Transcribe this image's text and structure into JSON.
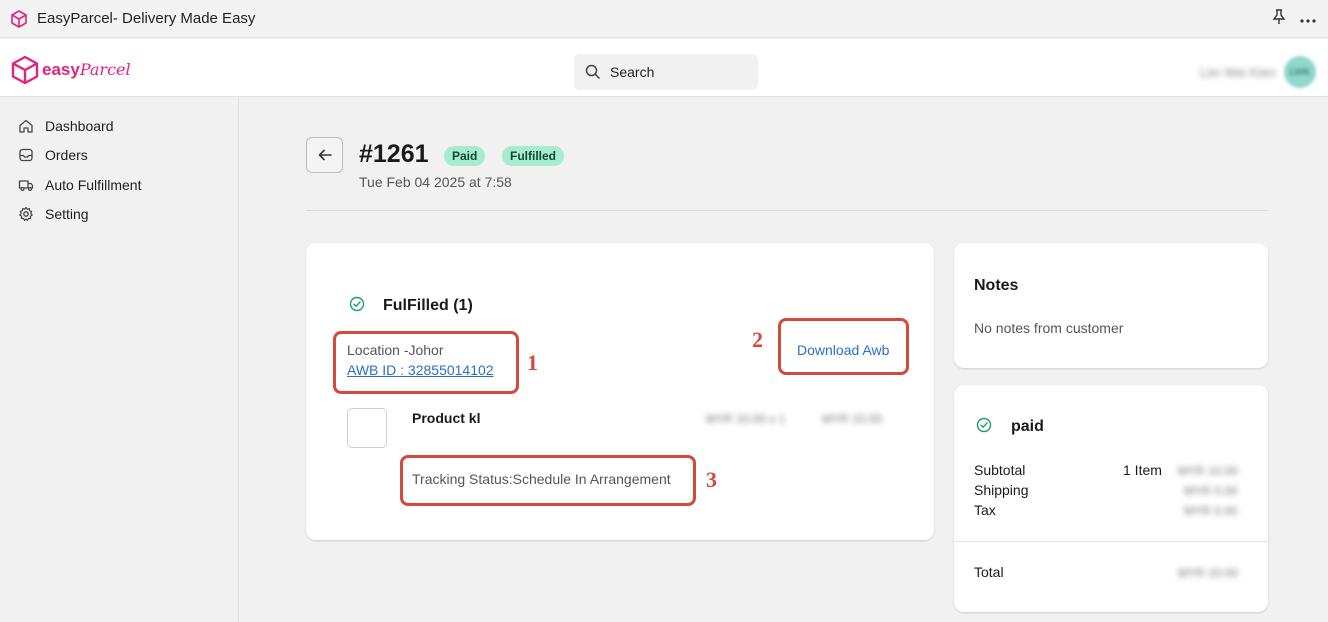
{
  "window": {
    "title": "EasyParcel- Delivery Made Easy",
    "pin_icon": "pin-icon",
    "more_icon": "more-horizontal-icon"
  },
  "header": {
    "logo_text_bold": "easy",
    "logo_text_script": "Parcel",
    "search_placeholder": "Search",
    "user_name": "Lim Wei Kien",
    "avatar_initials": "LWK"
  },
  "sidebar": {
    "items": [
      {
        "label": "Dashboard",
        "icon": "home-icon"
      },
      {
        "label": "Orders",
        "icon": "inbox-icon"
      },
      {
        "label": "Auto Fulfillment",
        "icon": "truck-icon"
      },
      {
        "label": "Setting",
        "icon": "gear-icon"
      }
    ]
  },
  "order": {
    "id": "#1261",
    "badges": [
      "Paid",
      "Fulfilled"
    ],
    "date": "Tue Feb 04 2025 at 7:58"
  },
  "fulfillment": {
    "title": "FulFilled (1)",
    "location": "Location -Johor",
    "awb_link": "AWB ID : 32855014102",
    "download_label": "Download Awb",
    "product_name": "Product kl",
    "product_unit_price": "MYR 10.00 x 1",
    "product_total": "MYR 10.00",
    "tracking_status": "Tracking Status:Schedule In Arrangement"
  },
  "annotations": [
    "1",
    "2",
    "3"
  ],
  "notes": {
    "title": "Notes",
    "text": "No notes from customer"
  },
  "payment": {
    "title": "paid",
    "subtotal_label": "Subtotal",
    "subtotal_qty": "1 Item",
    "subtotal_value": "MYR 10.00",
    "shipping_label": "Shipping",
    "shipping_value": "MYR 0.00",
    "tax_label": "Tax",
    "tax_value": "MYR 0.00",
    "total_label": "Total",
    "total_value": "MYR 10.00"
  },
  "colors": {
    "brand": "#e0237d",
    "link": "#2c6ecb",
    "badge_bg": "#a8ecd0",
    "annotation": "#d14a3a",
    "success": "#1a9e6e"
  }
}
